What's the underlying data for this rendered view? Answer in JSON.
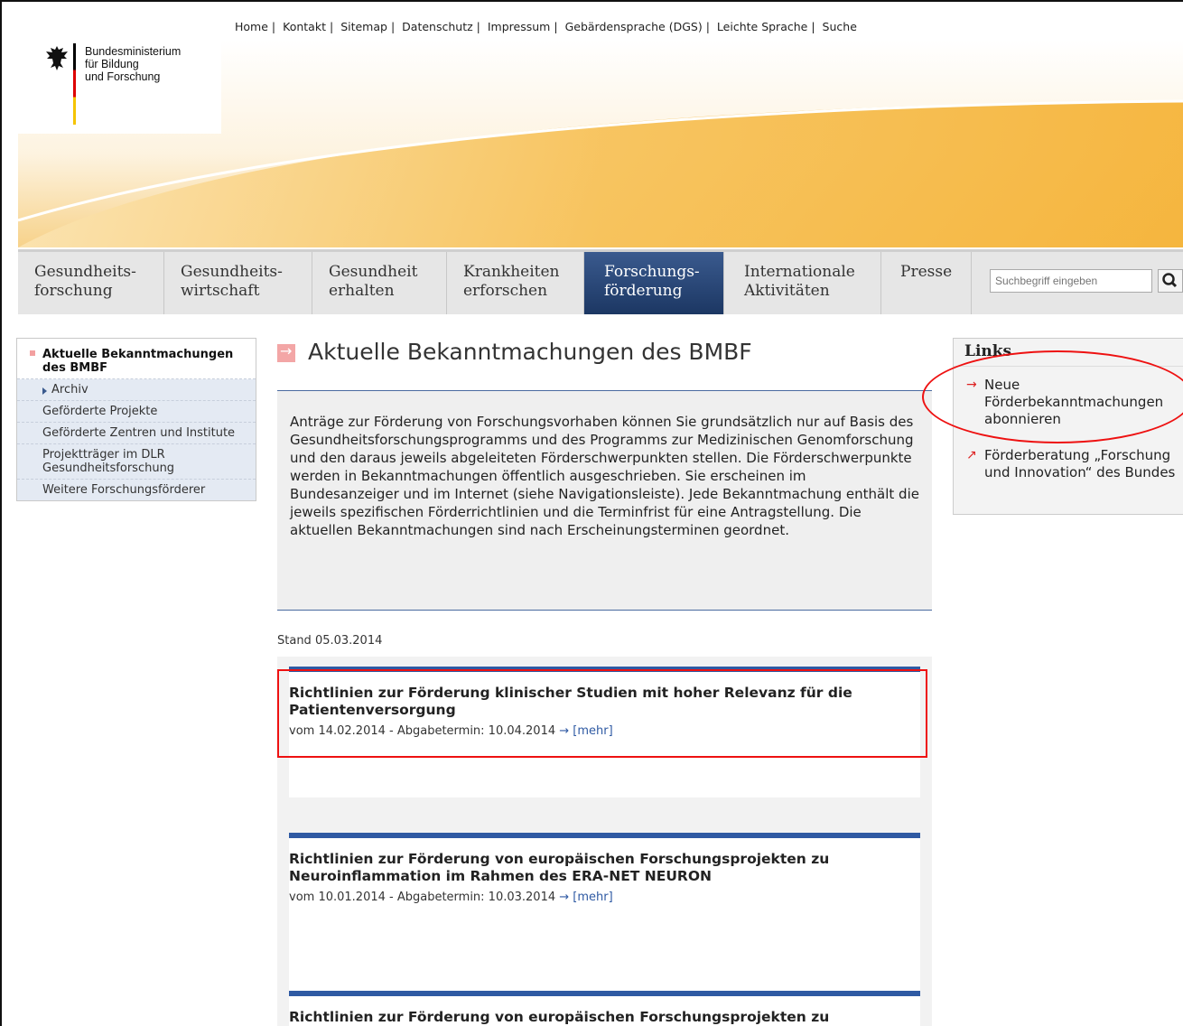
{
  "topnav": {
    "items": [
      "Home",
      "Kontakt",
      "Sitemap",
      "Datenschutz",
      "Impressum",
      "Gebärdensprache (DGS)",
      "Leichte Sprache",
      "Suche"
    ]
  },
  "logo": {
    "line1": "Bundesministerium",
    "line2": "für Bildung",
    "line3": "und Forschung"
  },
  "mainnav": {
    "items": [
      {
        "l1": "Gesundheits-",
        "l2": "forschung"
      },
      {
        "l1": "Gesundheits-",
        "l2": "wirtschaft"
      },
      {
        "l1": "Gesundheit",
        "l2": "erhalten"
      },
      {
        "l1": "Krankheiten",
        "l2": "erforschen"
      },
      {
        "l1": "Forschungs-",
        "l2": "förderung"
      },
      {
        "l1": "Internationale",
        "l2": "Aktivitäten"
      },
      {
        "l1": "Presse",
        "l2": ""
      }
    ],
    "search_placeholder": "Suchbegriff eingeben"
  },
  "sidebar": {
    "items": [
      "Aktuelle Bekanntmachungen des BMBF",
      "Archiv",
      "Geförderte Projekte",
      "Geförderte Zentren und Institute",
      "Projektträger im DLR Gesundheitsforschung",
      "Weitere Forschungsförderer"
    ]
  },
  "main": {
    "title": "Aktuelle Bekanntmachungen des BMBF",
    "intro": "Anträge zur Förderung von Forschungsvorhaben können Sie grundsätzlich nur auf Basis des Gesundheitsforschungsprogramms und des Programms zur Medizinischen Genomforschung und den daraus jeweils abgeleiteten Förderschwerpunkten stellen. Die Förderschwerpunkte werden in Bekanntmachungen öffentlich ausgeschrieben. Sie erscheinen im Bundesanzeiger und im Internet (siehe Navigationsleiste). Jede Bekanntmachung enthält die jeweils spezifischen Förderrichtlinien und die Terminfrist für eine Antragstellung. Die aktuellen Bekanntmachungen sind nach Erscheinungsterminen geordnet.",
    "stand": "Stand 05.03.2014",
    "entries": [
      {
        "title": "Richtlinien zur Förderung klinischer Studien mit hoher Relevanz für die Patientenversorgung",
        "meta": "vom 14.02.2014 - Abgabetermin: 10.04.2014",
        "more": "→ [mehr]"
      },
      {
        "title": "Richtlinien zur Förderung von europäischen Forschungsprojekten zu Neuroinflammation im Rahmen des ERA-NET NEURON",
        "meta": "vom 10.01.2014 - Abgabetermin: 10.03.2014",
        "more": "→ [mehr]"
      },
      {
        "title": "Richtlinien zur Förderung von europäischen Forschungsprojekten zu",
        "meta": "",
        "more": ""
      }
    ]
  },
  "links": {
    "heading": "Links",
    "items": [
      {
        "label": "Neue Förderbekanntmachungen abonnieren",
        "icon": "arrow-right-icon"
      },
      {
        "label": "Förderberatung „Forschung und Innovation“ des Bundes",
        "icon": "arrow-external-icon"
      }
    ]
  },
  "colors": {
    "accent_blue": "#2f5aa3",
    "nav_active": "#1c3763",
    "annotation_red": "#e11111",
    "banner_orange": "#f5b43a"
  }
}
